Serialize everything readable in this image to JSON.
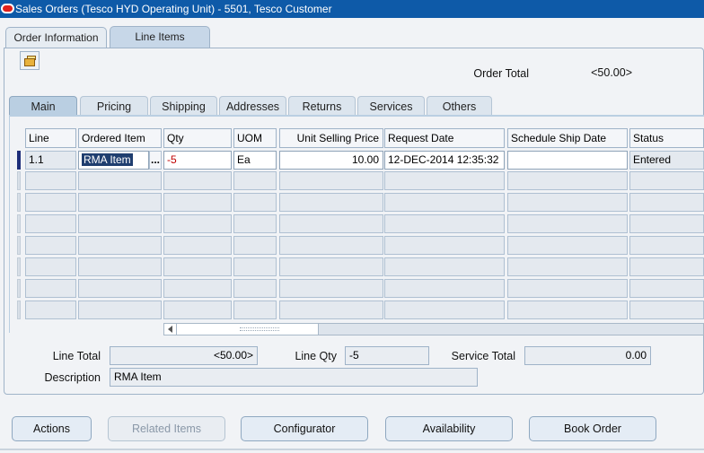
{
  "window": {
    "title": "Sales Orders (Tesco HYD Operating Unit) - 5501, Tesco Customer"
  },
  "top_tabs": [
    {
      "label": "Order Information",
      "active": false
    },
    {
      "label": "Line Items",
      "active": true
    }
  ],
  "order_total": {
    "label": "Order Total",
    "value": "<50.00>"
  },
  "sub_tabs": [
    "Main",
    "Pricing",
    "Shipping",
    "Addresses",
    "Returns",
    "Services",
    "Others"
  ],
  "sub_tab_active": "Main",
  "grid": {
    "columns": [
      "Line",
      "Ordered Item",
      "Qty",
      "UOM",
      "Unit Selling Price",
      "Request Date",
      "Schedule Ship Date",
      "Status"
    ],
    "row1": {
      "line": "1.1",
      "ordered_item": "RMA Item",
      "lov_button": "...",
      "qty": "-5",
      "uom": "Ea",
      "unit_selling_price": "10.00",
      "request_date": "12-DEC-2014 12:35:32",
      "schedule_ship_date": "",
      "status": "Entered"
    },
    "empty_row_count": 7
  },
  "footer": {
    "line_total_label": "Line Total",
    "line_total": "<50.00>",
    "line_qty_label": "Line Qty",
    "line_qty": "-5",
    "service_total_label": "Service Total",
    "service_total": "0.00",
    "description_label": "Description",
    "description": "RMA Item"
  },
  "buttons": {
    "actions": "Actions",
    "related_items": "Related Items",
    "configurator": "Configurator",
    "availability": "Availability",
    "book_order": "Book Order"
  },
  "colors": {
    "title_bar": "#0E5AA8",
    "qty_negative": "#C00000",
    "selection": "#1F3E6F"
  },
  "icons": {
    "attachment": "folder-attach-icon",
    "app": "oracle-icon"
  }
}
